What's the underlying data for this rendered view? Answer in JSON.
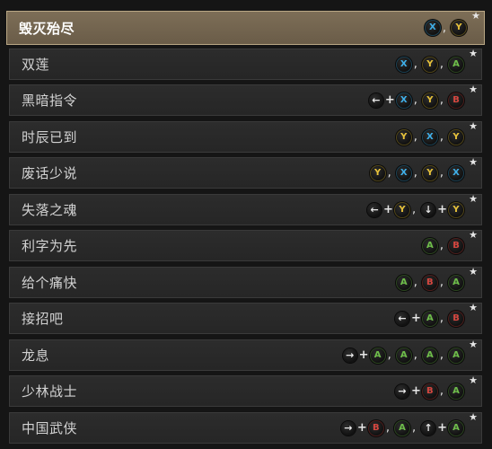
{
  "colors": {
    "X": "#3fb0ea",
    "Y": "#e7c23a",
    "A": "#6ebe4a",
    "B": "#d5463f"
  },
  "icons": {
    "left": "dpad-left-icon",
    "right": "dpad-right-icon",
    "up": "dpad-up-icon",
    "down": "dpad-down-icon"
  },
  "moves": [
    {
      "name": "毁灭殆尽",
      "selected": true,
      "favorite": true,
      "combo": [
        [
          "X"
        ],
        [
          "Y"
        ]
      ]
    },
    {
      "name": "双莲",
      "selected": false,
      "favorite": true,
      "combo": [
        [
          "X"
        ],
        [
          "Y"
        ],
        [
          "A"
        ]
      ]
    },
    {
      "name": "黑暗指令",
      "selected": false,
      "favorite": true,
      "combo": [
        [
          "left",
          "X"
        ],
        [
          "Y"
        ],
        [
          "B"
        ]
      ]
    },
    {
      "name": "时辰已到",
      "selected": false,
      "favorite": true,
      "combo": [
        [
          "Y"
        ],
        [
          "X"
        ],
        [
          "Y"
        ]
      ]
    },
    {
      "name": "废话少说",
      "selected": false,
      "favorite": true,
      "combo": [
        [
          "Y"
        ],
        [
          "X"
        ],
        [
          "Y"
        ],
        [
          "X"
        ]
      ]
    },
    {
      "name": "失落之魂",
      "selected": false,
      "favorite": true,
      "combo": [
        [
          "left",
          "Y"
        ],
        [
          "down",
          "Y"
        ]
      ]
    },
    {
      "name": "利字为先",
      "selected": false,
      "favorite": true,
      "combo": [
        [
          "A"
        ],
        [
          "B"
        ]
      ]
    },
    {
      "name": "给个痛快",
      "selected": false,
      "favorite": true,
      "combo": [
        [
          "A"
        ],
        [
          "B"
        ],
        [
          "A"
        ]
      ]
    },
    {
      "name": "接招吧",
      "selected": false,
      "favorite": true,
      "combo": [
        [
          "left",
          "A"
        ],
        [
          "B"
        ]
      ]
    },
    {
      "name": "龙息",
      "selected": false,
      "favorite": true,
      "combo": [
        [
          "right",
          "A"
        ],
        [
          "A"
        ],
        [
          "A"
        ],
        [
          "A"
        ]
      ]
    },
    {
      "name": "少林战士",
      "selected": false,
      "favorite": true,
      "combo": [
        [
          "right",
          "B"
        ],
        [
          "A"
        ]
      ]
    },
    {
      "name": "中国武侠",
      "selected": false,
      "favorite": true,
      "combo": [
        [
          "right",
          "B"
        ],
        [
          "A"
        ],
        [
          "up",
          "A"
        ]
      ]
    }
  ]
}
